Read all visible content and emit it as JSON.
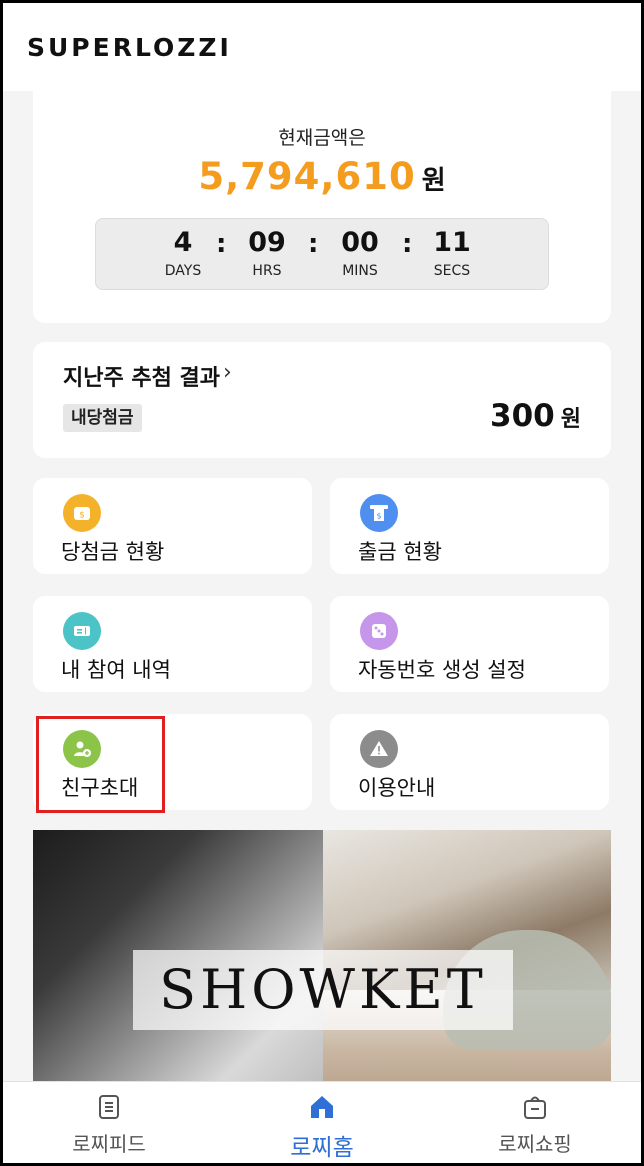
{
  "app": {
    "logo": "SUPERLOZZI"
  },
  "prize": {
    "label": "현재금액은",
    "amount": "5,794,610",
    "unit": "원",
    "amount_color": "#f39c1e",
    "countdown": [
      {
        "value": "4",
        "label": "DAYS"
      },
      {
        "value": "09",
        "label": "HRS"
      },
      {
        "value": "00",
        "label": "MINS"
      },
      {
        "value": "11",
        "label": "SECS"
      }
    ],
    "separator": ":"
  },
  "last_week": {
    "title": "지난주 추첨 결과",
    "chevron": "›",
    "badge": "내당첨금",
    "amount": "300",
    "unit": "원"
  },
  "menu": [
    {
      "label": "당첨금 현황",
      "icon": "wallet-icon",
      "color": "#f4b22a"
    },
    {
      "label": "출금 현황",
      "icon": "atm-withdraw-icon",
      "color": "#4f8ff0"
    },
    {
      "label": "내 참여 내역",
      "icon": "ticket-icon",
      "color": "#4cc3c6"
    },
    {
      "label": "자동번호 생성 설정",
      "icon": "dice-icon",
      "color": "#c596ea"
    },
    {
      "label": "친구초대",
      "icon": "add-friend-icon",
      "color": "#8cc44a"
    },
    {
      "label": "이용안내",
      "icon": "warning-icon",
      "color": "#8c8c8c"
    }
  ],
  "banner": {
    "brand": "SHOWKET"
  },
  "bottom_nav": [
    {
      "label": "로찌피드",
      "icon": "feed-icon",
      "active": false
    },
    {
      "label": "로찌홈",
      "icon": "home-icon",
      "active": true
    },
    {
      "label": "로찌쇼핑",
      "icon": "shopping-bag-icon",
      "active": false
    }
  ],
  "colors": {
    "accent": "#2f6fd6",
    "highlight": "#e02020"
  }
}
